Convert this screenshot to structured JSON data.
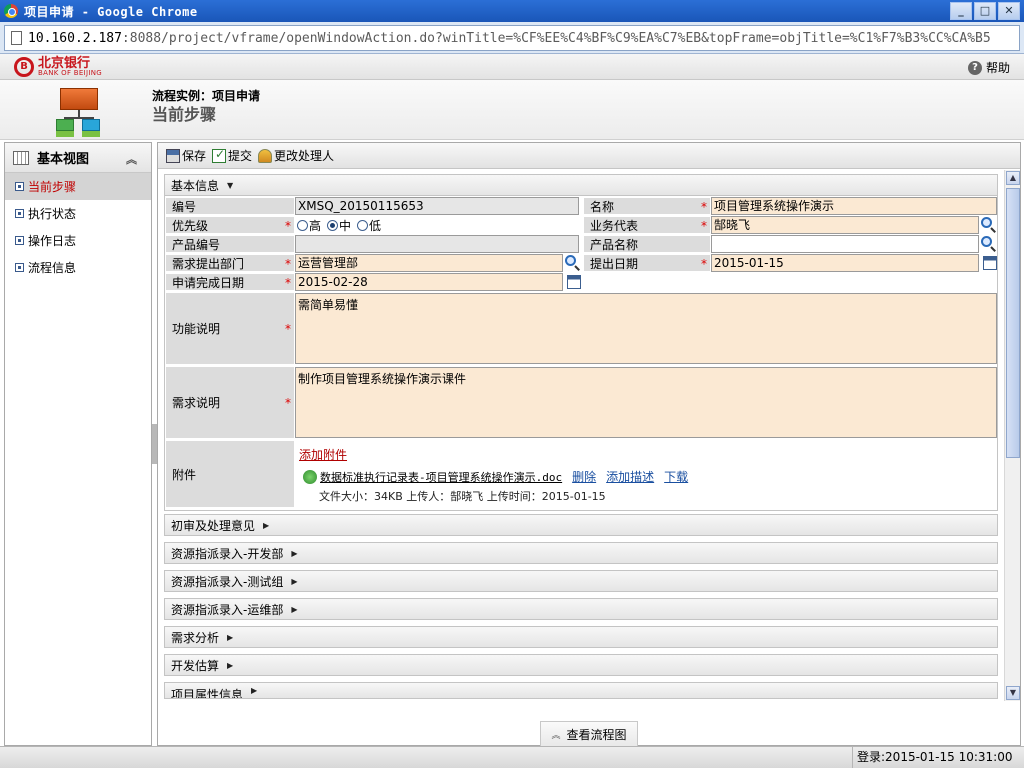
{
  "window": {
    "title": "项目申请 - Google Chrome"
  },
  "address": {
    "host": "10.160.2.187",
    "rest": ":8088/project/vframe/openWindowAction.do?winTitle=%CF%EE%C4%BF%C9%EA%C7%EB&topFrame=objTitle=%C1%F7%B3%CC%CA%B5"
  },
  "brand": {
    "cn": "北京银行",
    "en": "BANK OF BEIJING"
  },
  "header": {
    "help": "帮助"
  },
  "page": {
    "instance_label": "流程实例：项目申请",
    "current_step": "当前步骤"
  },
  "leftnav": {
    "title": "基本视图",
    "items": [
      {
        "label": "当前步骤",
        "active": true
      },
      {
        "label": "执行状态"
      },
      {
        "label": "操作日志"
      },
      {
        "label": "流程信息"
      }
    ]
  },
  "toolbar": {
    "save": "保存",
    "submit": "提交",
    "change_handler": "更改处理人"
  },
  "basic_section": {
    "title": "基本信息"
  },
  "form": {
    "code_label": "编号",
    "code_value": "XMSQ_20150115653",
    "name_label": "名称",
    "name_value": "项目管理系统操作演示",
    "priority_label": "优先级",
    "priority_options": [
      "高",
      "中",
      "低"
    ],
    "priority_selected": "中",
    "biz_rep_label": "业务代表",
    "biz_rep_value": "郜晓飞",
    "product_code_label": "产品编号",
    "product_code_value": "",
    "product_name_label": "产品名称",
    "product_name_value": "",
    "dept_label": "需求提出部门",
    "dept_value": "运营管理部",
    "submit_date_label": "提出日期",
    "submit_date_value": "2015-01-15",
    "complete_date_label": "申请完成日期",
    "complete_date_value": "2015-02-28",
    "func_label": "功能说明",
    "func_value": "需简单易懂",
    "req_label": "需求说明",
    "req_value": "制作项目管理系统操作演示课件",
    "attach_label": "附件",
    "add_attachment": "添加附件",
    "attachment_name": "数据标准执行记录表-项目管理系统操作演示.doc",
    "delete": "删除",
    "add_desc": "添加描述",
    "download": "下载",
    "attachment_meta": "文件大小：34KB 上传人：郜晓飞 上传时间：2015-01-15"
  },
  "sections": [
    "初审及处理意见",
    "资源指派录入-开发部",
    "资源指派录入-测试组",
    "资源指派录入-运维部",
    "需求分析",
    "开发估算",
    "项目属性信息"
  ],
  "flow_button": "查看流程图",
  "status": {
    "login": "登录:2015-01-15 10:31:00"
  }
}
